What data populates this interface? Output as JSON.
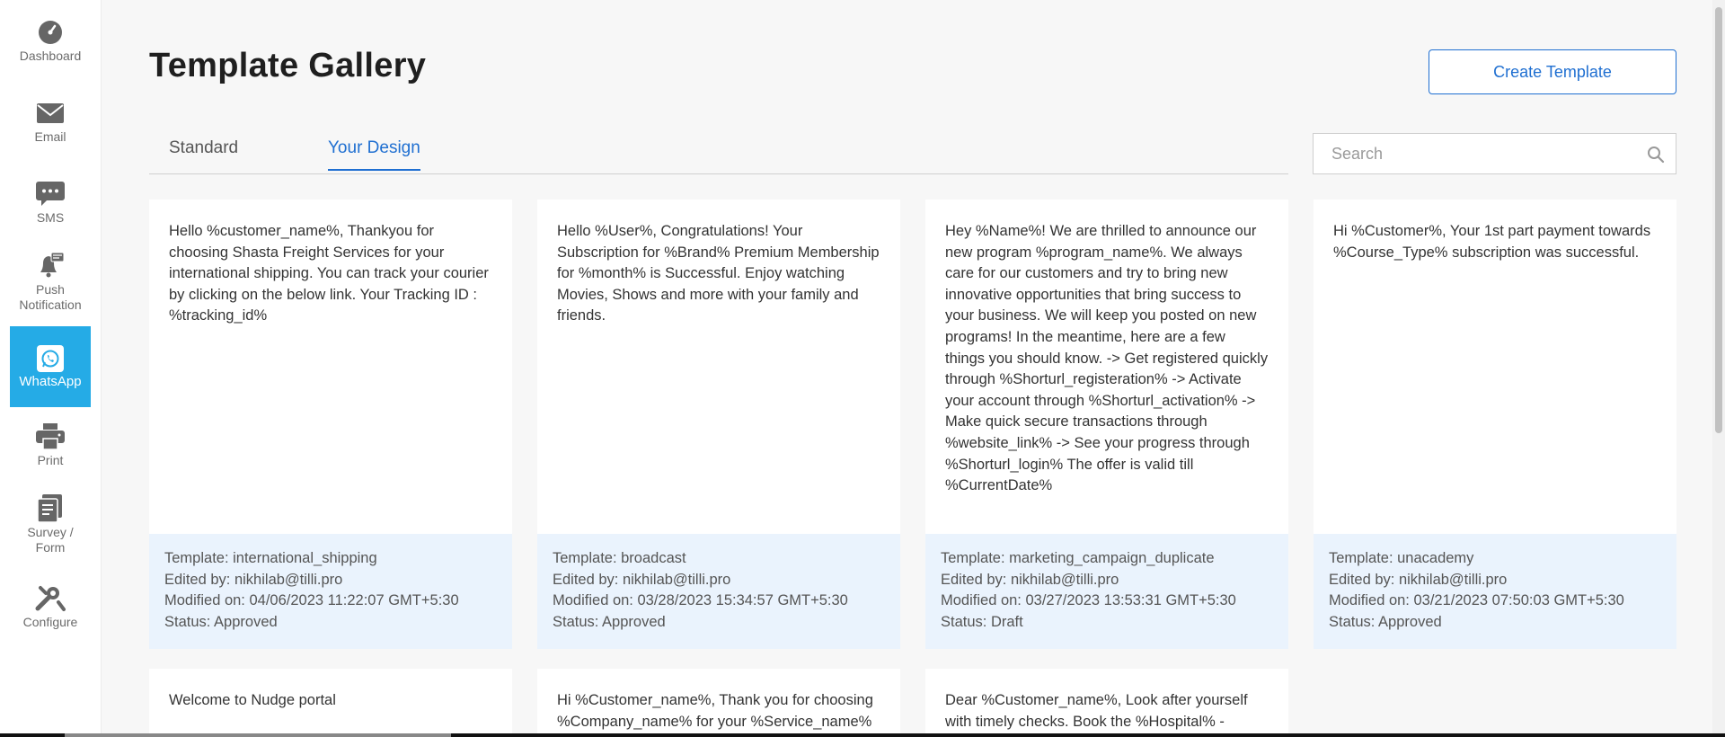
{
  "sidebar": {
    "items": [
      {
        "label": "Dashboard",
        "icon": "gauge-icon"
      },
      {
        "label": "Email",
        "icon": "envelope-icon"
      },
      {
        "label": "SMS",
        "icon": "chat-bubble-icon"
      },
      {
        "label": "Push Notification",
        "icon": "bell-icon"
      },
      {
        "label": "WhatsApp",
        "icon": "whatsapp-icon"
      },
      {
        "label": "Print",
        "icon": "printer-icon"
      },
      {
        "label": "Survey / Form",
        "icon": "form-icon"
      },
      {
        "label": "Configure",
        "icon": "tools-icon"
      }
    ]
  },
  "header": {
    "title": "Template Gallery",
    "create_label": "Create Template"
  },
  "tabs": [
    {
      "label": "Standard"
    },
    {
      "label": "Your Design"
    }
  ],
  "search": {
    "placeholder": "Search",
    "value": ""
  },
  "cards": [
    {
      "body": "Hello %customer_name%, Thankyou for choosing Shasta Freight Services for your international shipping. You can track your courier by clicking on the below link. Your Tracking ID : %tracking_id%",
      "template": "Template: international_shipping",
      "edited": "Edited by: nikhilab@tilli.pro",
      "modified": "Modified on: 04/06/2023 11:22:07 GMT+5:30",
      "status": "Status: Approved"
    },
    {
      "body": "Hello %User%, Congratulations! Your Subscription for %Brand% Premium Membership for %month% is Successful. Enjoy watching Movies, Shows and more with your family and friends.",
      "template": "Template: broadcast",
      "edited": "Edited by: nikhilab@tilli.pro",
      "modified": "Modified on: 03/28/2023 15:34:57 GMT+5:30",
      "status": "Status: Approved"
    },
    {
      "body": "Hey %Name%! We are thrilled to announce our new program %program_name%. We always care for our customers and try to bring new innovative opportunities that bring success to your business. We will keep you posted on new programs! In the meantime, here are a few things you should know. -> Get registered quickly through %Shorturl_registeration% -> Activate your account through %Shorturl_activation% -> Make quick secure transactions through %website_link% -> See your progress through %Shorturl_login% The offer is valid till %CurrentDate%",
      "template": "Template: marketing_campaign_duplicate",
      "edited": "Edited by: nikhilab@tilli.pro",
      "modified": "Modified on: 03/27/2023 13:53:31 GMT+5:30",
      "status": "Status: Draft"
    },
    {
      "body": "Hi %Customer%, Your 1st part payment towards %Course_Type% subscription was successful.",
      "template": "Template: unacademy",
      "edited": "Edited by: nikhilab@tilli.pro",
      "modified": "Modified on: 03/21/2023 07:50:03 GMT+5:30",
      "status": "Status: Approved"
    }
  ],
  "cards_row2": [
    {
      "body": "Welcome to Nudge portal"
    },
    {
      "body": "Hi %Customer_name%, Thank you for choosing %Company_name% for your %Service_name%"
    },
    {
      "body": "Dear %Customer_name%, Look after yourself with timely checks. Book the %Hospital% - Basic."
    }
  ],
  "colors": {
    "accent": "#1f6fd1",
    "active_nav": "#25abe6",
    "meta_bg": "#eaf3fd"
  }
}
